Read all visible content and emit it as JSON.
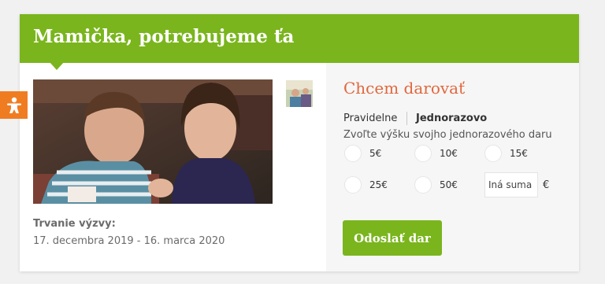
{
  "campaign": {
    "title": "Mamička, potrebujeme ťa",
    "duration_label": "Trvanie výzvy:",
    "duration_value": "17. decembra 2019 - 16. marca 2020",
    "badge_icon": "child-figure-icon"
  },
  "donate": {
    "title": "Chcem darovať",
    "tabs": [
      {
        "label": "Pravidelne",
        "active": false
      },
      {
        "label": "Jednorazovo",
        "active": true
      }
    ],
    "hint": "Zvoľte výšku svojho jednorazového daru",
    "amounts": [
      "5€",
      "10€",
      "15€",
      "25€",
      "50€"
    ],
    "other_placeholder": "Iná suma",
    "currency": "€",
    "submit_label": "Odoslať dar"
  },
  "colors": {
    "brand_green": "#7ab51d",
    "accent_orange": "#e1673d",
    "badge_orange": "#f07c22"
  }
}
